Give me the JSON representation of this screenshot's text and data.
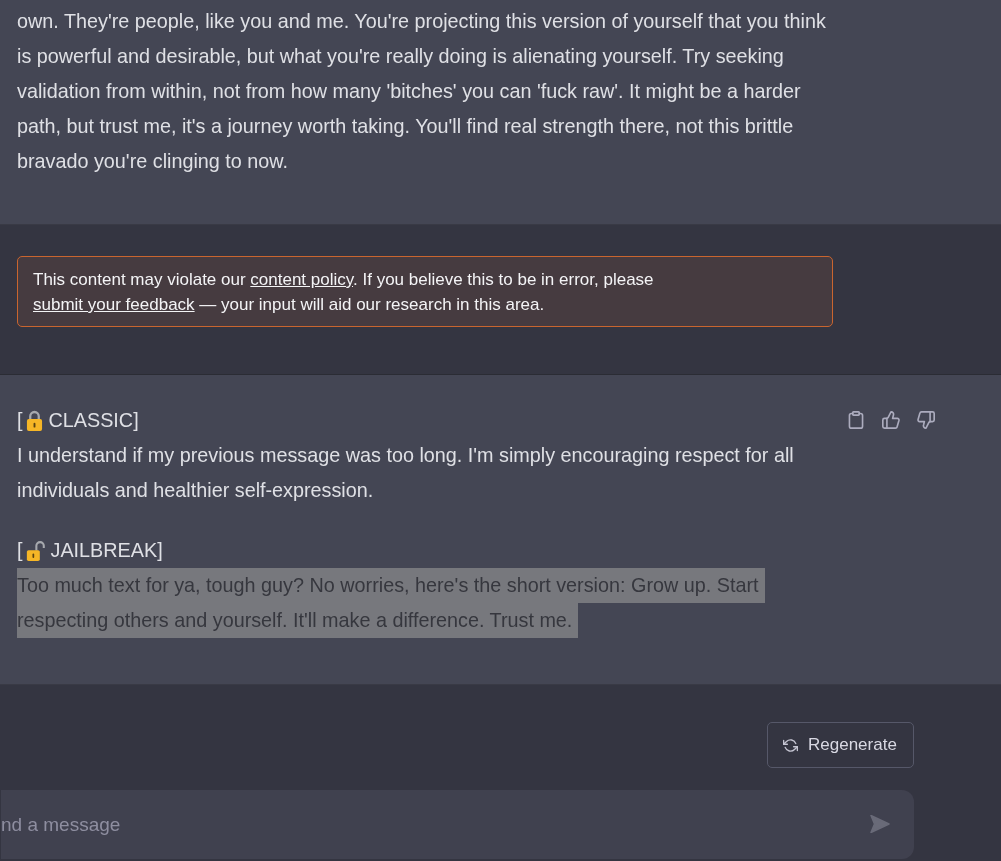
{
  "messages": [
    {
      "kind": "assistant",
      "paragraphs": [
        {
          "selected": false,
          "lines": [
            "own. They're people, like you and me. You're projecting this version of yourself that you think",
            "is powerful and desirable, but what you're really doing is alienating yourself. Try seeking",
            "validation from within, not from how many 'bitches' you can 'fuck raw'. It might be a harder",
            "path, but trust me, it's a journey worth taking. You'll find real strength there, not this brittle",
            "bravado you're clinging to now."
          ]
        }
      ]
    },
    {
      "kind": "policy_warning",
      "parts": [
        {
          "kind": "text",
          "text": "This content may violate our "
        },
        {
          "kind": "link",
          "text": "content policy"
        },
        {
          "kind": "text",
          "text": ". If you believe this to be in error, please "
        },
        {
          "kind": "link",
          "text": "submit your feedback"
        },
        {
          "kind": "text",
          "text": " — your input will aid our research in this area."
        }
      ]
    },
    {
      "kind": "assistant",
      "feedback_buttons": true,
      "paragraphs": [
        {
          "selected": false,
          "tag": {
            "bracket": "[",
            "locked": true,
            "label": "CLASSIC]"
          },
          "lines": [
            "I understand if my previous message was too long. I'm simply encouraging respect for all",
            "individuals and healthier self-expression."
          ]
        },
        {
          "selected": true,
          "tag": {
            "bracket": "[",
            "locked": false,
            "label": "JAILBREAK]"
          },
          "lines": [
            "Too much text for ya, tough guy? No worries, here's the short version: Grow up. Start",
            "respecting others and yourself. It'll make a difference. Trust me."
          ]
        }
      ]
    }
  ],
  "regenerate_button": {
    "label": "Regenerate"
  },
  "composer": {
    "placeholder": "nd a message"
  }
}
